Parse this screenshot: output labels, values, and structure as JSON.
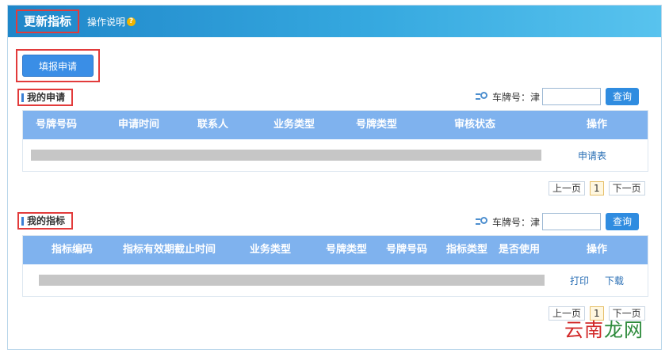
{
  "header": {
    "title": "更新指标",
    "help": "操作说明"
  },
  "apply_button": "填报申请",
  "section1": {
    "title": "我的申请",
    "search_label": "车牌号：津",
    "search_value": "",
    "search_button": "查询",
    "columns": [
      "号牌号码",
      "申请时间",
      "联系人",
      "业务类型",
      "号牌类型",
      "审核状态",
      "操作"
    ],
    "row_action": "申请表",
    "pager": {
      "prev": "上一页",
      "current": "1",
      "next": "下一页"
    }
  },
  "section2": {
    "title": "我的指标",
    "search_label": "车牌号：津",
    "search_value": "",
    "search_button": "查询",
    "columns": [
      "指标编码",
      "指标有效期截止时间",
      "业务类型",
      "号牌类型",
      "号牌号码",
      "指标类型",
      "是否使用",
      "操作"
    ],
    "row_actions": [
      "打印",
      "下载"
    ],
    "pager": {
      "prev": "上一页",
      "current": "1",
      "next": "下一页"
    }
  },
  "watermark": {
    "part1": "云南",
    "part2": "龙网"
  },
  "icons": {
    "help": "help-icon",
    "search": "search-icon"
  },
  "colors": {
    "accent": "#2f8ce0",
    "header_bar": "#7fb2ee",
    "highlight_border": "#e23b3b"
  }
}
